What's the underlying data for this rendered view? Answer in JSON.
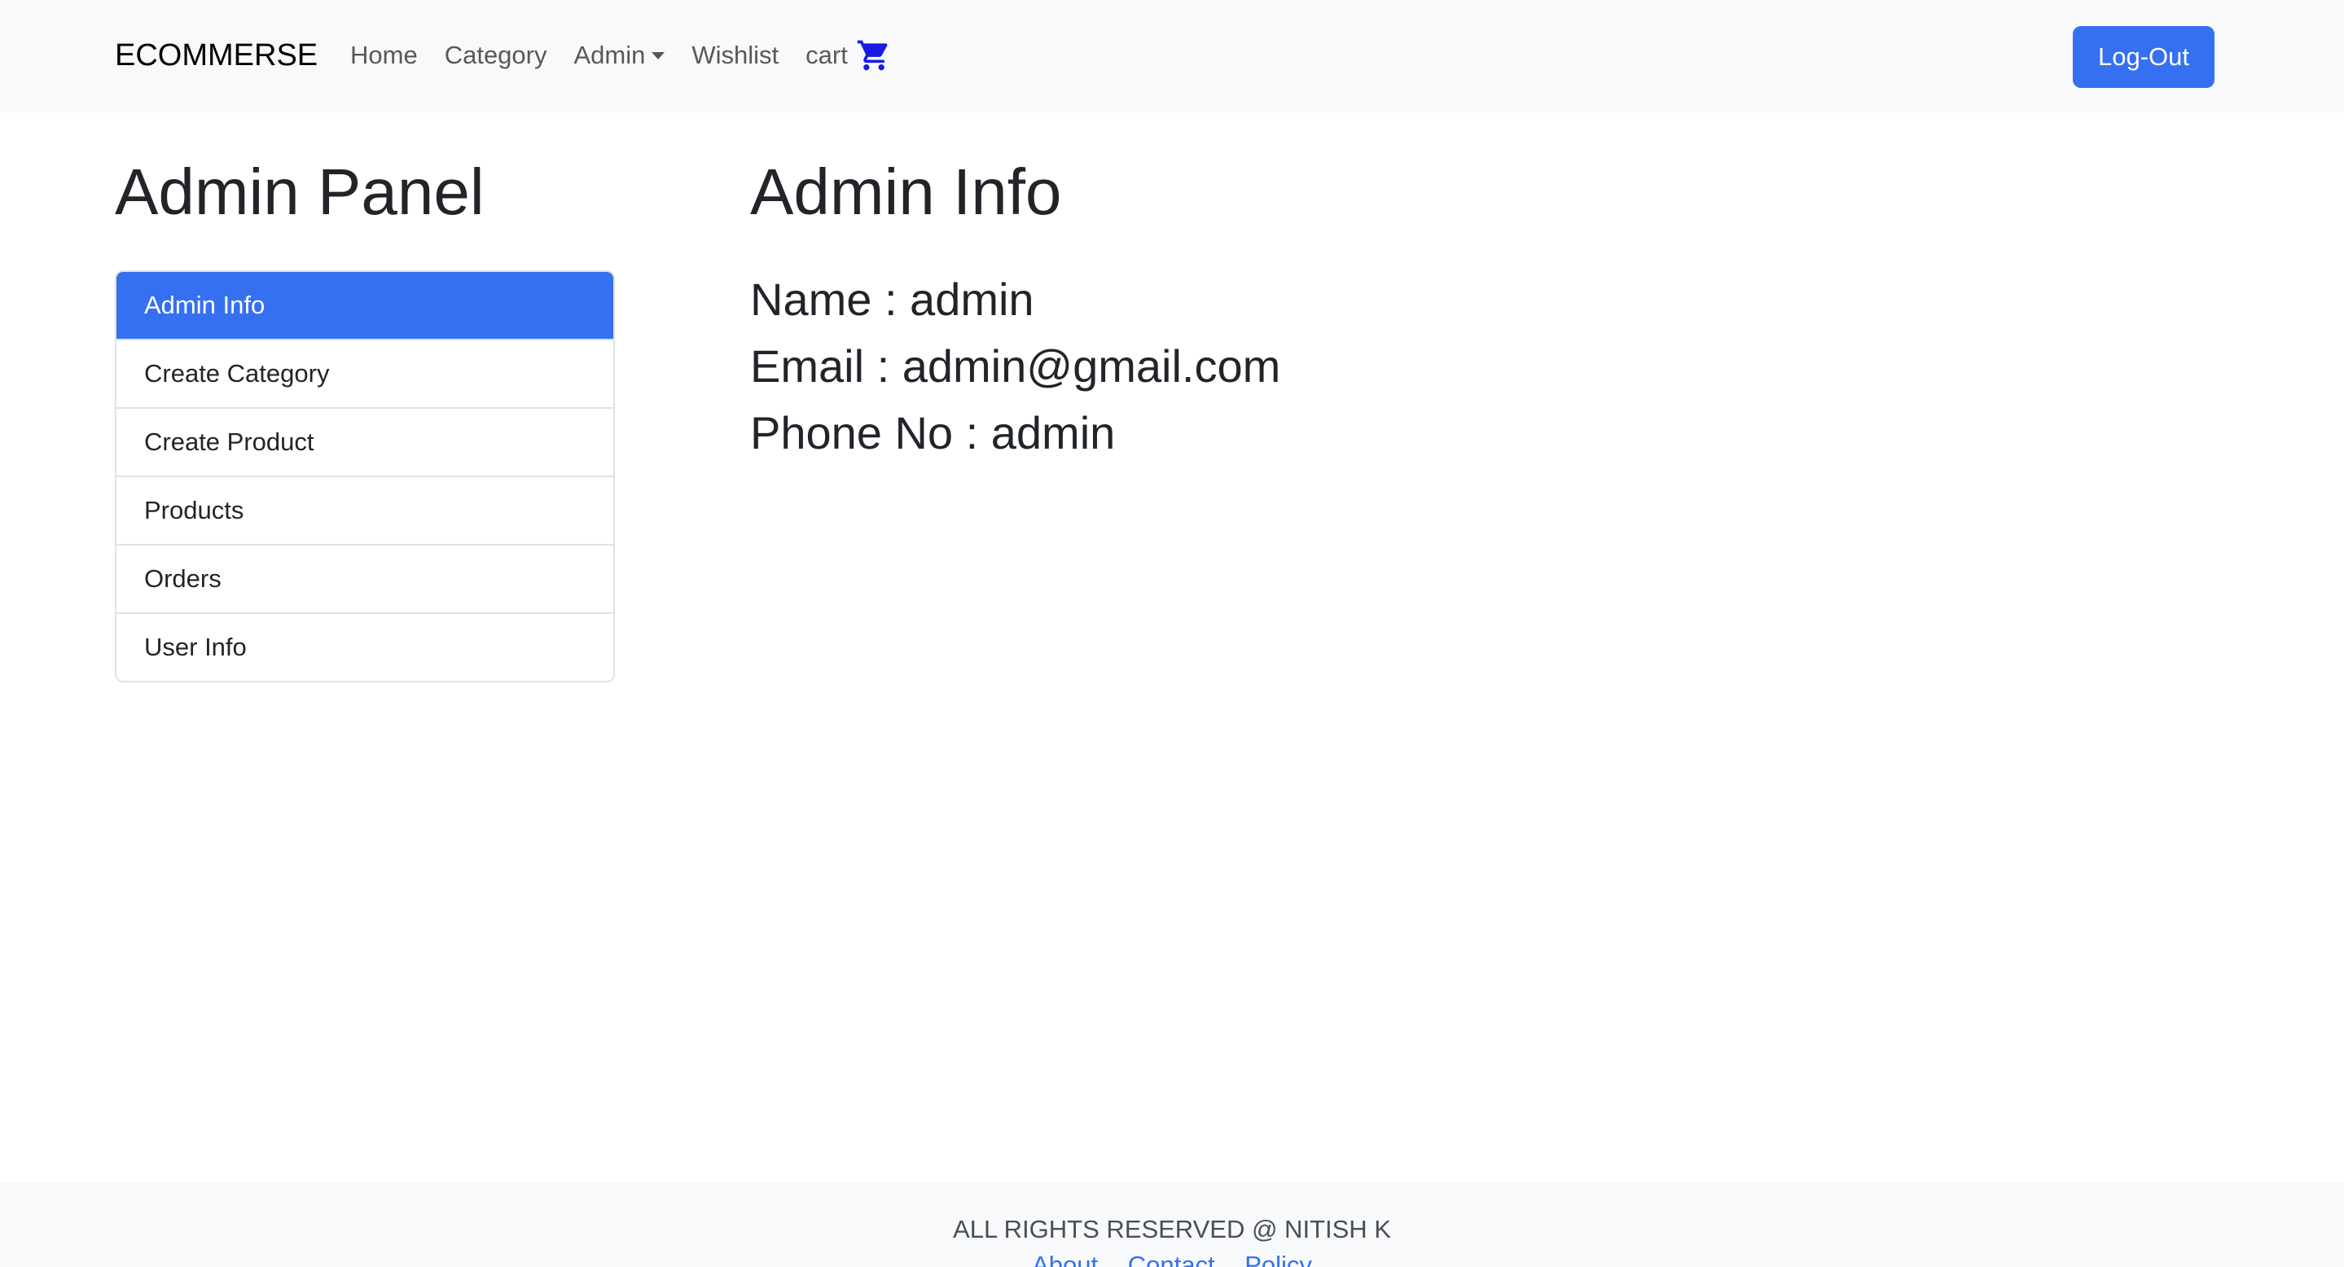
{
  "navbar": {
    "brand": "ECOMMERSE",
    "links": {
      "home": "Home",
      "category": "Category",
      "admin": "Admin",
      "wishlist": "Wishlist",
      "cart": "cart"
    },
    "cart_icon": "shopping-cart-icon",
    "logout_label": "Log-Out"
  },
  "sidebar": {
    "title": "Admin Panel",
    "items": [
      {
        "label": "Admin Info",
        "active": true
      },
      {
        "label": "Create Category",
        "active": false
      },
      {
        "label": "Create Product",
        "active": false
      },
      {
        "label": "Products",
        "active": false
      },
      {
        "label": "Orders",
        "active": false
      },
      {
        "label": "User Info",
        "active": false
      }
    ]
  },
  "main": {
    "title": "Admin Info",
    "name_line": "Name : admin",
    "email_line": "Email : admin@gmail.com",
    "phone_line": "Phone No : admin"
  },
  "footer": {
    "text": "ALL RIGHTS RESERVED @ NITISH K",
    "links": {
      "about": "About",
      "contact": "Contact",
      "policy": "Policy"
    }
  },
  "colors": {
    "primary": "#3470f0",
    "navbar_bg": "#f8f9fa",
    "cart_icon": "#1a1ae6",
    "text": "#212529"
  }
}
